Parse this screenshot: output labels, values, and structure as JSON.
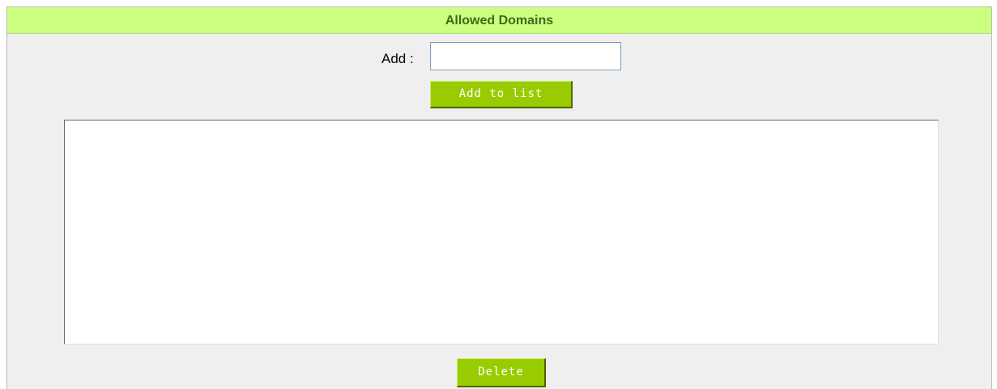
{
  "panel": {
    "title": "Allowed Domains"
  },
  "add_field": {
    "label": "Add :",
    "value": "",
    "placeholder": ""
  },
  "buttons": {
    "add_to_list": "Add to list",
    "delete": "Delete"
  },
  "domain_list": {
    "items": []
  },
  "colors": {
    "header_bg": "#ccff80",
    "header_text": "#3d6b1a",
    "panel_bg": "#efefef",
    "button_bg": "#99cc00",
    "button_text": "#ffffff"
  }
}
